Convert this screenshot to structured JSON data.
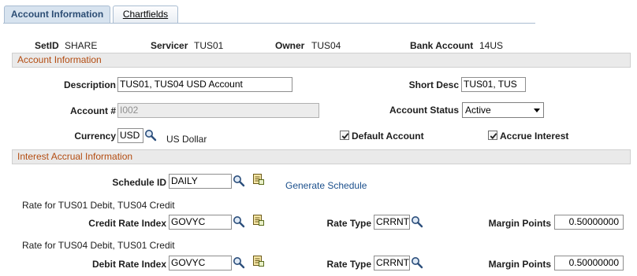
{
  "tabs": [
    {
      "label": "Account Information",
      "active": true
    },
    {
      "label": "Chartfields",
      "active": false
    }
  ],
  "header": {
    "setid_label": "SetID",
    "setid_value": "SHARE",
    "servicer_label": "Servicer",
    "servicer_value": "TUS01",
    "owner_label": "Owner",
    "owner_value": "TUS04",
    "bank_account_label": "Bank Account",
    "bank_account_value": "14US"
  },
  "account_section": {
    "title": "Account Information",
    "description_label": "Description",
    "description_value": "TUS01, TUS04 USD Account",
    "short_desc_label": "Short Desc",
    "short_desc_value": "TUS01, TUS",
    "account_num_label": "Account #",
    "account_num_value": "I002",
    "account_status_label": "Account Status",
    "account_status_value": "Active",
    "currency_label": "Currency",
    "currency_value": "USD",
    "currency_desc": "US Dollar",
    "default_account_label": "Default Account",
    "default_account_checked": true,
    "accrue_interest_label": "Accrue Interest",
    "accrue_interest_checked": true
  },
  "interest_section": {
    "title": "Interest Accrual Information",
    "schedule_id_label": "Schedule ID",
    "schedule_id_value": "DAILY",
    "generate_schedule_link": "Generate Schedule",
    "credit_heading": "Rate for TUS01 Debit, TUS04 Credit",
    "credit_rate_index_label": "Credit Rate Index",
    "credit_rate_index_value": "GOVYC",
    "credit_rate_type_label": "Rate Type",
    "credit_rate_type_value": "CRRNT",
    "credit_margin_label": "Margin Points",
    "credit_margin_value": "0.50000000",
    "debit_heading": "Rate for TUS04 Debit, TUS01 Credit",
    "debit_rate_index_label": "Debit Rate Index",
    "debit_rate_index_value": "GOVYC",
    "debit_rate_type_label": "Rate Type",
    "debit_rate_type_value": "CRRNT",
    "debit_margin_label": "Margin Points",
    "debit_margin_value": "0.50000000"
  },
  "icons": {
    "lookup": "magnifier-icon",
    "prompt_detail": "detail-page-icon"
  },
  "colors": {
    "section_title": "#b34c11",
    "link": "#1b4f8c",
    "tab_border": "#a9bcd1"
  }
}
